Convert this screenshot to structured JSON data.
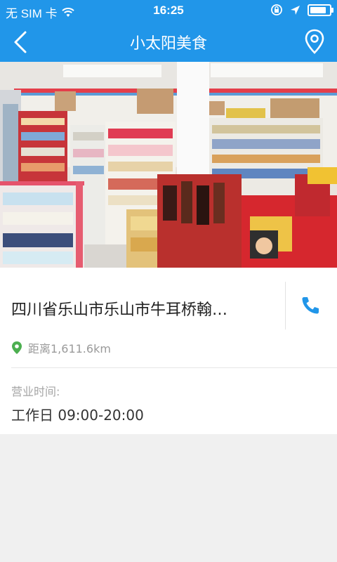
{
  "status_bar": {
    "carrier": "无 SIM 卡",
    "time": "16:25"
  },
  "nav": {
    "title": "小太阳美食",
    "back_icon": "chevron-left-icon",
    "location_icon": "location-pin-icon"
  },
  "store": {
    "photo_icon": "store-photo",
    "address": "四川省乐山市乐山市牛耳桥翰…",
    "distance_label": "距离1,611.6km",
    "hours_label": "营业时间:",
    "hours_value": "工作日 09:00-20:00"
  },
  "colors": {
    "primary": "#2196e9",
    "pin_green": "#4caf50",
    "text_dark": "#222222",
    "text_gray": "#9a9a9a"
  }
}
